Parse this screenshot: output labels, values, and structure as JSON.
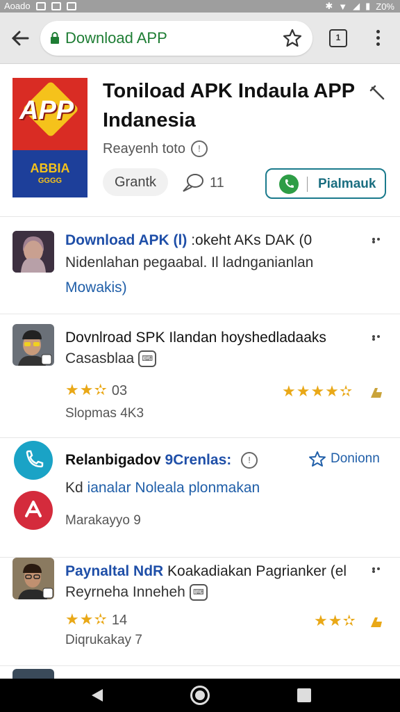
{
  "status_bar": {
    "left_text": "Aoado",
    "right_text": "Z0%"
  },
  "browser": {
    "url": "Download APP",
    "tab_count": "1"
  },
  "app": {
    "logo_text": "APP",
    "logo_sub1": "ABBIA",
    "logo_sub2": "GGGG",
    "title": "Toniload APK Indaula APP Indanesia",
    "subtitle": "Reayenh toto",
    "chip_label": "Grantk",
    "comment_count": "11",
    "install_label": "Pialmauk"
  },
  "items": [
    {
      "title_accent": "Download APK (l)",
      "title_rest": " :okeht AKs  DAK (0",
      "line": "Nidenlahan pegaabal. Il ladnganianlan",
      "link": "Mowakis)"
    },
    {
      "title": "Dovnlroad SPK Ilandan hoyshedladaaks",
      "line": "Casasblaa",
      "badge": "⌨",
      "rating_left": "03",
      "meta": "Slopmas 4K3"
    },
    {
      "title": "Relanbigadov",
      "title_accent": " 9Crenlas:",
      "follow_label": "Donionn",
      "line_dark": "Kd ",
      "line_accent": "ianalar Noleala plonmakan",
      "meta": "Marakayyo 9"
    },
    {
      "title_accent": "Paynaltal NdR",
      "title_rest": " Koakadiakan Pagrianker (el",
      "line": "Reyrneha Inneheh",
      "badge": "⌨",
      "rating_left": "14",
      "meta": "Diqrukakay 7"
    }
  ],
  "colors": {
    "accent_blue": "#1f4fa8",
    "install_border": "#1a7a8c",
    "star": "#e9a817",
    "url_green": "#1e7d34"
  }
}
